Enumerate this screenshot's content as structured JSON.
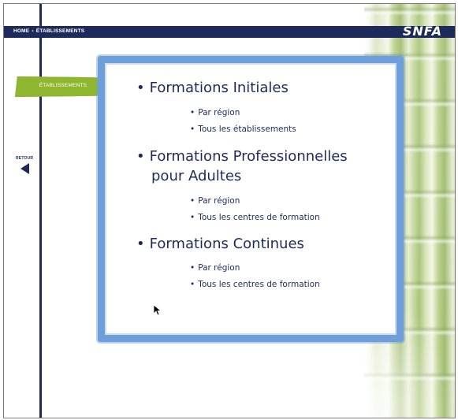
{
  "header": {
    "breadcrumb": [
      "HOME",
      "ÉTABLISSEMENTS"
    ],
    "logo": "SNFA"
  },
  "sidebar": {
    "active_tab": "ÉTABLISSEMENTS",
    "back_label": "RETOUR"
  },
  "colors": {
    "navy": "#1f2a5c",
    "green": "#8fb62f",
    "frame_blue": "#6f9fd8"
  },
  "sections": [
    {
      "title": "Formations Initiales",
      "links": [
        "Par région",
        "Tous les établissements"
      ]
    },
    {
      "title_line1": "Formations Professionnelles",
      "title_line2": "pour Adultes",
      "links": [
        "Par région",
        "Tous les centres de formation"
      ]
    },
    {
      "title": "Formations Continues",
      "links": [
        "Par région",
        "Tous les centres de formation"
      ]
    }
  ]
}
